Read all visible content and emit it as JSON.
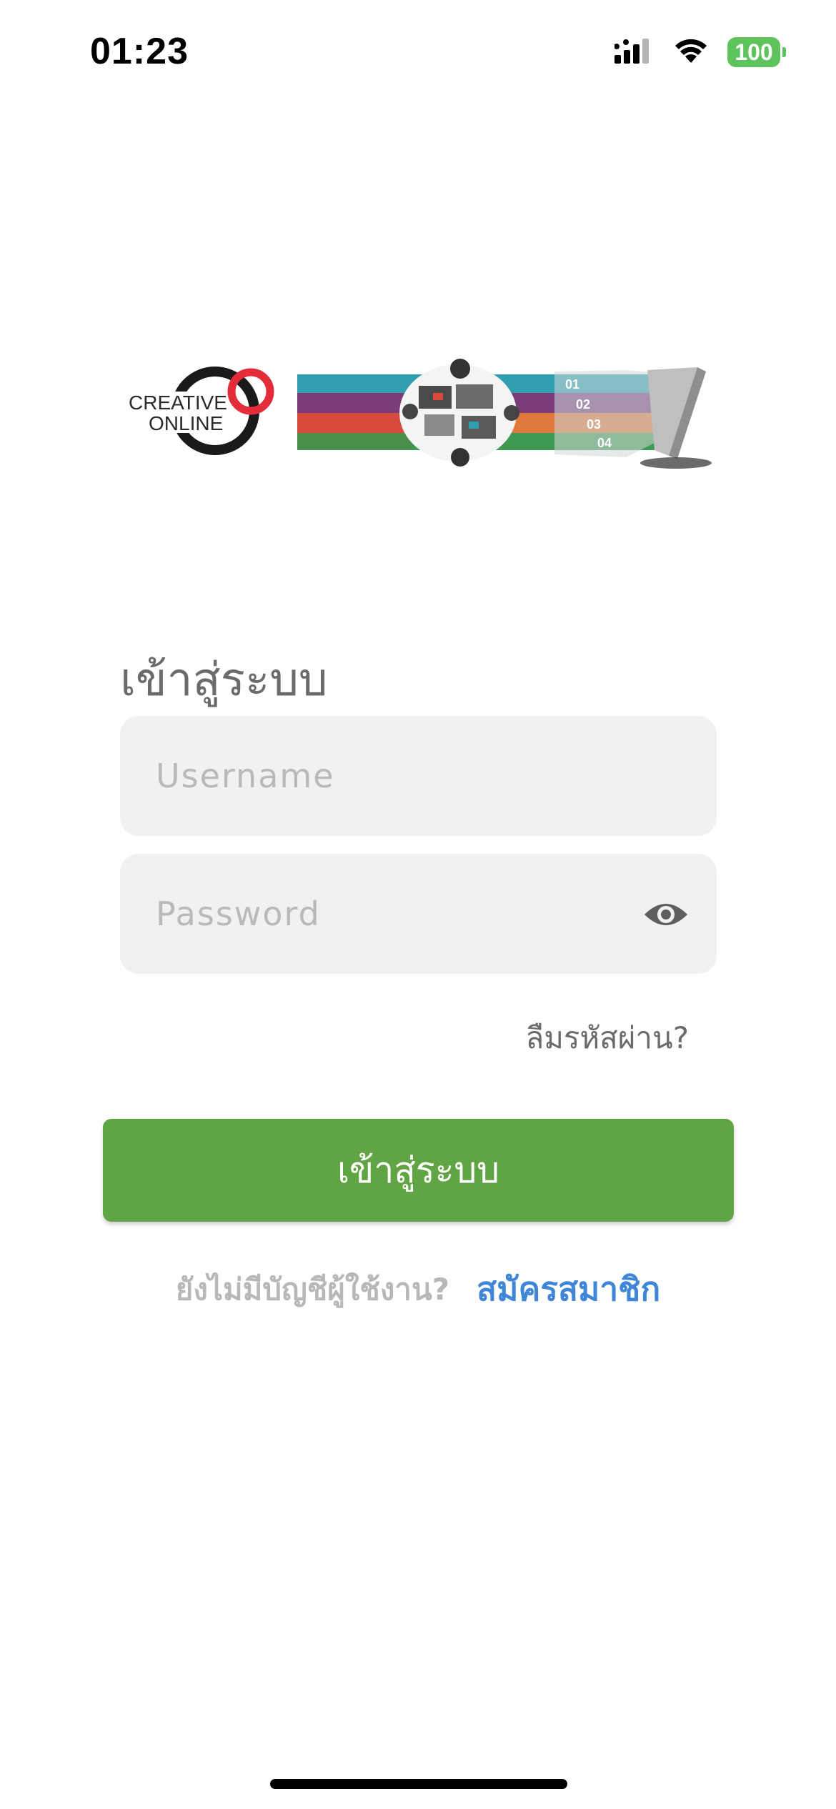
{
  "status_bar": {
    "time": "01:23",
    "battery_level": "100",
    "icons": [
      "cellular-signal-icon",
      "wifi-icon",
      "battery-icon"
    ]
  },
  "logo": {
    "line1": "CREATIVE",
    "line2": "ONLINE",
    "banner_numbers": [
      "01",
      "02",
      "03",
      "04"
    ]
  },
  "login_form": {
    "heading": "เข้าสู่ระบบ",
    "username_placeholder": "Username",
    "password_placeholder": "Password",
    "forgot_password_label": "ลืมรหัสผ่าน?",
    "submit_label": "เข้าสู่ระบบ",
    "signup_prompt": "ยังไม่มีบัญชีผู้ใช้งาน?",
    "signup_link_label": "สมัครสมาชิก"
  },
  "colors": {
    "primary_button": "#61a443",
    "link": "#3f86d8",
    "input_background": "#f1f1f1",
    "logo_ring_red": "#e42c3b",
    "battery": "#5ec25d"
  }
}
